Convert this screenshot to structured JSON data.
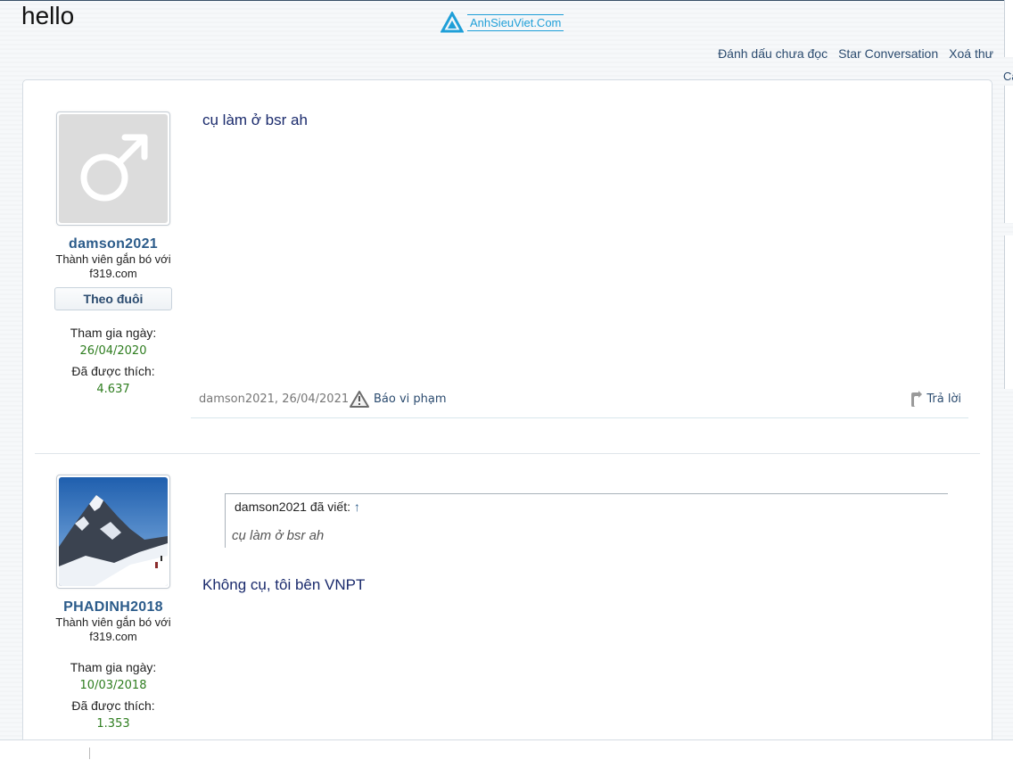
{
  "conversation": {
    "title": "hello"
  },
  "logo": {
    "text": "AnhSieuViet.Com"
  },
  "actions": {
    "mark_unread": "Đánh dấu chưa đọc",
    "star": "Star Conversation",
    "delete": "Xoá thư"
  },
  "right_edge_text": "Ca",
  "messages": [
    {
      "author": "damson2021",
      "user_title": "Thành viên gắn bó với f319.com",
      "follow_label": "Theo đuôi",
      "joined_label": "Tham gia ngày:",
      "joined_value": "26/04/2020",
      "likes_label": "Đã được thích:",
      "likes_value": "4.637",
      "text": "cụ làm ở bsr ah",
      "meta": "damson2021, 26/04/2021",
      "report_label": "Báo vi phạm",
      "reply_label": "Trả lời"
    },
    {
      "author": "PHADINH2018",
      "user_title": "Thành viên gắn bó với f319.com",
      "joined_label": "Tham gia ngày:",
      "joined_value": "10/03/2018",
      "likes_label": "Đã được thích:",
      "likes_value": "1.353",
      "quote_attribution": "damson2021 đã viết:",
      "quote_arrow": "↑",
      "quote_text": "cụ làm ở bsr ah",
      "text": "Không cụ, tôi bên VNPT"
    }
  ],
  "colors": {
    "link": "#2b4b6f",
    "username": "#2b5b8a",
    "stat_value": "#2e7d1f",
    "message_text": "#1a2a6c",
    "logo": "#1f9fd8"
  },
  "icons": [
    "logo-triangle-icon",
    "male-symbol-icon",
    "warning-triangle-icon",
    "reply-arrow-icon"
  ]
}
